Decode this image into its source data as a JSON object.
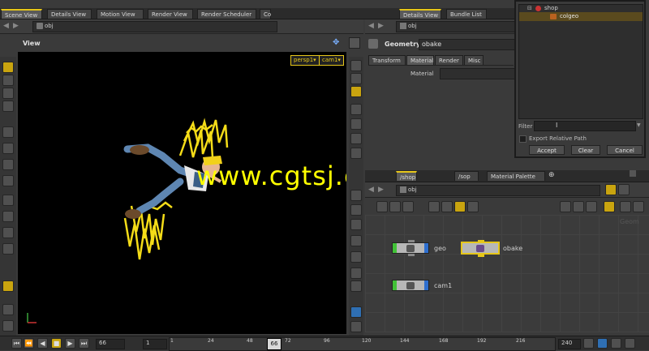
{
  "left_tabs": [
    "Scene View",
    "Details View",
    "Motion View",
    "Render View",
    "Render Scheduler",
    "Co"
  ],
  "right_tabs": [
    "Details View",
    "Bundle List"
  ],
  "path_left": "obj",
  "path_right": "obj",
  "viewport": {
    "title": "View",
    "persp_label": "persp1▾",
    "cam_label": "cam1▾",
    "watermark": "www.cgtsj.com"
  },
  "params": {
    "type_label": "Geometry",
    "node_name": "obake",
    "tabs": [
      "Transform",
      "Material",
      "Render",
      "Misc"
    ],
    "field_label": "Material"
  },
  "chooser": {
    "tree_root": "shop",
    "tree_child": "colgeo",
    "filter_label": "Filter",
    "export_label": "Export Relative Path",
    "accept": "Accept",
    "clear": "Clear",
    "cancel": "Cancel"
  },
  "network": {
    "tabs": [
      "/shop",
      "/sop",
      "Material Palette"
    ],
    "path": "obj",
    "watermark": "Geom",
    "nodes": [
      {
        "label": "geo"
      },
      {
        "label": "obake"
      },
      {
        "label": "cam1"
      }
    ]
  },
  "timeline": {
    "current_frame": "66",
    "start_frame": "1",
    "end_frame": "240",
    "frame_marker": "66",
    "ticks": [
      "1",
      "24",
      "48",
      "72",
      "96",
      "120",
      "144",
      "168",
      "192",
      "216"
    ]
  },
  "colors": {
    "accent": "#e6c619",
    "node_input": "#41c237",
    "node_output": "#2e6fcf",
    "watermark": "#ffff00"
  }
}
